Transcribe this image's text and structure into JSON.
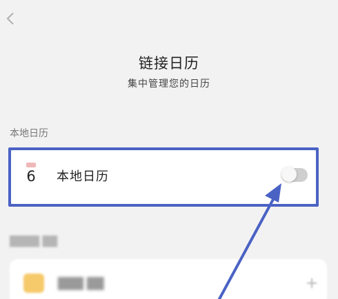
{
  "header": {
    "back_icon": "chevron-left-icon",
    "title": "链接日历",
    "subtitle": "集中管理您的日历"
  },
  "local_section": {
    "label": "本地日历",
    "item": {
      "icon": "calendar-icon",
      "icon_day": "6",
      "title": "本地日历",
      "toggle_on": false
    }
  },
  "other_section": {
    "item_icon": "mailbox-icon",
    "add_icon": "plus-icon"
  },
  "colors": {
    "highlight": "#4a62c4",
    "background": "#f2f2f2",
    "card": "#ffffff"
  }
}
